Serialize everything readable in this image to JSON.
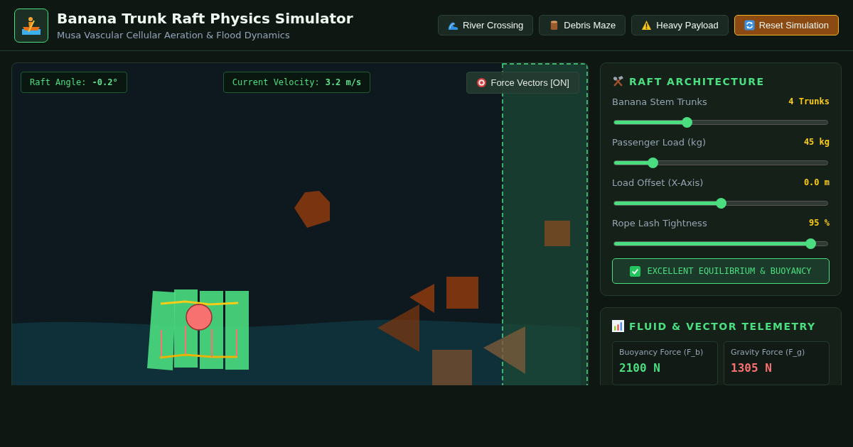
{
  "header": {
    "title": "Banana Trunk Raft Physics Simulator",
    "subtitle": "Musa Vascular Cellular Aeration & Flood Dynamics",
    "buttons": [
      {
        "kind": "wave",
        "label": "River Crossing",
        "primary": false
      },
      {
        "kind": "log",
        "label": "Debris Maze",
        "primary": false
      },
      {
        "kind": "warning",
        "label": "Heavy Payload",
        "primary": false
      },
      {
        "kind": "reload",
        "label": "Reset Simulation",
        "primary": true
      }
    ]
  },
  "simulation": {
    "readouts": [
      {
        "label": "Raft Angle:",
        "value": "-0.2°"
      },
      {
        "label": "Current Velocity:",
        "value": "3.2 m/s"
      }
    ],
    "force_toggle": {
      "label": "Force Vectors [ON]",
      "on": true
    }
  },
  "architecture": {
    "title": "RAFT ARCHITECTURE",
    "sliders": [
      {
        "label": "Banana Stem Trunks",
        "reading": "4 Trunks",
        "level": 0.34
      },
      {
        "label": "Passenger Load (kg)",
        "reading": "45 kg",
        "level": 0.18
      },
      {
        "label": "Load Offset (X-Axis)",
        "reading": "0.0 m",
        "level": 0.5
      },
      {
        "label": "Rope Lash Tightness",
        "reading": "95 %",
        "level": 0.92
      }
    ],
    "status": "EXCELLENT EQUILIBRIUM & BUOYANCY"
  },
  "telemetry": {
    "title": "FLUID & VECTOR TELEMETRY",
    "metrics": [
      {
        "label": "Buoyancy Force (F_b)",
        "value": "2100 N",
        "kind": "positive"
      },
      {
        "label": "Gravity Force (F_g)",
        "value": "1305 N",
        "kind": "negative"
      }
    ]
  }
}
